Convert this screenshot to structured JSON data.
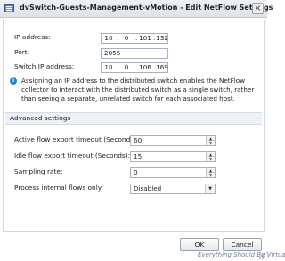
{
  "window": {
    "title": "dvSwitch-Guests-Management-vMotion - Edit NetFlow Settings",
    "close_glyph": "×"
  },
  "form": {
    "ip_address": {
      "label": "IP address:",
      "octets": [
        "10",
        "0",
        "101",
        "132"
      ]
    },
    "port": {
      "label": "Port:",
      "value": "2055"
    },
    "switch_ip": {
      "label": "Switch IP address:",
      "octets": [
        "10",
        "0",
        "106",
        "169"
      ]
    }
  },
  "info": {
    "icon": "info-icon",
    "text": "Assigning an IP address to the distributed switch enables the NetFlow collector to interact with the distributed switch as a single switch, rather than seeing a separate, unrelated switch for each associated host."
  },
  "advanced": {
    "heading": "Advanced settings",
    "active_timeout": {
      "label": "Active flow export timeout (Seconds):",
      "value": "60"
    },
    "idle_timeout": {
      "label": "Idle flow export timeout (Seconds):",
      "value": "15"
    },
    "sampling_rate": {
      "label": "Sampling rate:",
      "value": "0"
    },
    "internal_flows": {
      "label": "Process internal flows only:",
      "value": "Disabled"
    }
  },
  "buttons": {
    "ok": "OK",
    "cancel": "Cancel"
  },
  "glyphs": {
    "up": "▲",
    "down": "▼",
    "dropdown": "▼",
    "info": "i"
  },
  "watermark": "Everything Should Be Virtual"
}
